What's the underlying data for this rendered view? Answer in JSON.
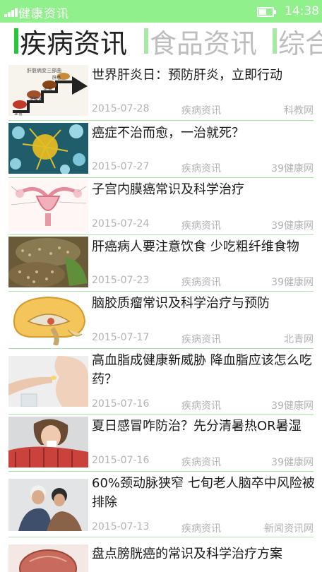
{
  "status_bar": {
    "app_title": "健康资讯",
    "time": "14:38",
    "battery_level": 0.55,
    "color": "#8ff08c"
  },
  "pivot": {
    "tabs": [
      {
        "label": "疾病资讯",
        "active": true
      },
      {
        "label": "食品资讯",
        "active": false
      },
      {
        "label": "综合",
        "active": false
      }
    ],
    "accent": "#27c53b"
  },
  "articles": [
    {
      "title": "世界肝炎日：预防肝炎，立即行动",
      "date": "2015-07-28",
      "category": "疾病资讯",
      "source": "科教网",
      "thumb_caption": "肝脏病变三部曲",
      "thumb_labels": [
        "正常",
        "肝硬化",
        "肝癌",
        "肝炎"
      ]
    },
    {
      "title": "癌症不治而愈，一治就死？",
      "date": "2015-07-27",
      "category": "疾病资讯",
      "source": "39健康网"
    },
    {
      "title": "子宫内膜癌常识及科学治疗",
      "date": "2015-07-24",
      "category": "疾病资讯",
      "source": "39健康网"
    },
    {
      "title": "肝癌病人要注意饮食 少吃粗纤维食物",
      "date": "2015-07-23",
      "category": "疾病资讯",
      "source": "39健康网"
    },
    {
      "title": "脑胶质瘤常识及科学治疗与预防",
      "date": "2015-07-17",
      "category": "疾病资讯",
      "source": "北青网"
    },
    {
      "title": "高血脂成健康新威胁 降血脂应该怎么吃药？",
      "date": "2015-07-16",
      "category": "疾病资讯",
      "source": "39健康网"
    },
    {
      "title": "夏日感冒咋防治？先分清暑热OR暑湿",
      "date": "2015-07-16",
      "category": "疾病资讯",
      "source": "39健康网"
    },
    {
      "title": "60%颈动脉狭窄 七旬老人脑卒中风险被排除",
      "date": "2015-07-13",
      "category": "疾病资讯",
      "source": "新闻资讯网"
    },
    {
      "title": "盘点膀胱癌的常识及科学治疗方案",
      "date": "",
      "category": "",
      "source": ""
    }
  ]
}
